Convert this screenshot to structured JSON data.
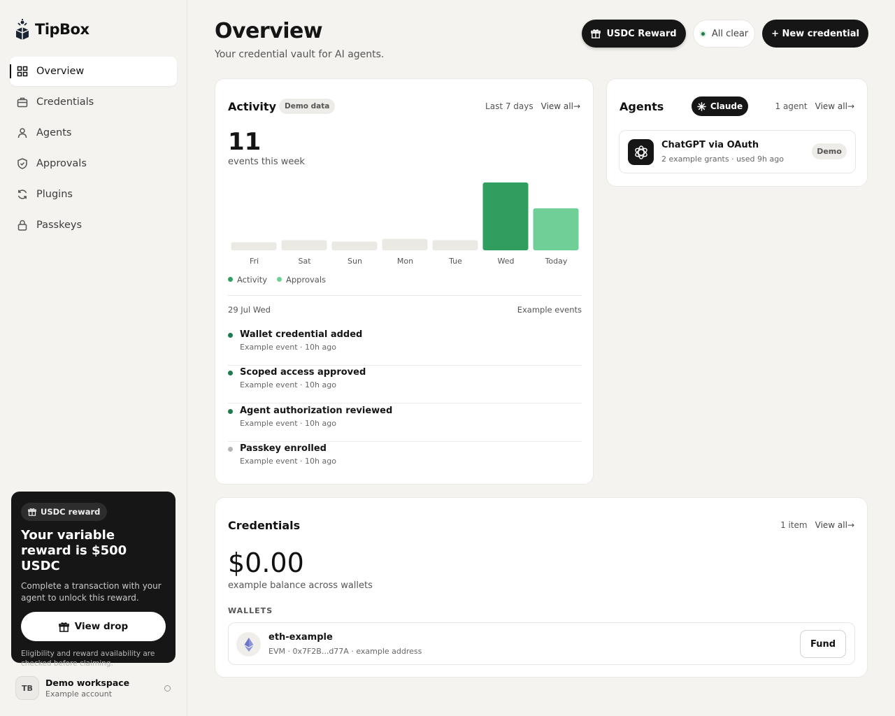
{
  "app": {
    "name": "TipBox"
  },
  "sidebar": {
    "items": [
      {
        "label": "Overview",
        "icon": "grid-icon",
        "active": true
      },
      {
        "label": "Credentials",
        "icon": "briefcase-icon"
      },
      {
        "label": "Agents",
        "icon": "user-icon"
      },
      {
        "label": "Approvals",
        "icon": "shield-check-icon"
      },
      {
        "label": "Plugins",
        "icon": "refresh-icon"
      },
      {
        "label": "Passkeys",
        "icon": "lock-icon"
      }
    ],
    "reward": {
      "pill": "USDC reward",
      "title": "Your variable reward is $500 USDC",
      "description": "Complete a transaction with your agent to unlock this reward.",
      "button": "View drop",
      "note": "Eligibility and reward availability are checked before claiming."
    },
    "workspace": {
      "initials": "TB",
      "name": "Demo workspace",
      "sub": "Example account"
    }
  },
  "header": {
    "title": "Overview",
    "subtitle": "Your credential vault for AI agents.",
    "usdc_button": "USDC Reward",
    "status": "All clear",
    "new_button": "+ New credential"
  },
  "activity": {
    "title": "Activity",
    "badge": "Demo data",
    "range": "Last 7 days",
    "view_all": "View all→",
    "count": "11",
    "count_label": "events this week",
    "legend": [
      "Activity",
      "Approvals"
    ],
    "date": "29 Jul Wed",
    "events_label": "Example events",
    "events": [
      {
        "title": "Wallet credential added",
        "sub": "Example event · 10h ago",
        "status": "green"
      },
      {
        "title": "Scoped access approved",
        "sub": "Example event · 10h ago",
        "status": "green"
      },
      {
        "title": "Agent authorization reviewed",
        "sub": "Example event · 10h ago",
        "status": "green"
      },
      {
        "title": "Passkey enrolled",
        "sub": "Example event · 10h ago",
        "status": "grey"
      }
    ]
  },
  "chart_data": {
    "type": "bar",
    "categories": [
      "Fri",
      "Sat",
      "Sun",
      "Mon",
      "Tue",
      "Wed",
      "Today"
    ],
    "values": [
      0.12,
      0.15,
      0.13,
      0.17,
      0.15,
      1.0,
      0.62
    ],
    "highlight": {
      "Wed": "#2f9e5f",
      "Today": "#6fcf97"
    },
    "base_color": "#ebe9e4"
  },
  "agents": {
    "title": "Agents",
    "filter": "Claude",
    "count": "1 agent",
    "view_all": "View all→",
    "items": [
      {
        "name": "ChatGPT via OAuth",
        "sub": "2 example grants · used 9h ago",
        "badge": "Demo"
      }
    ]
  },
  "credentials": {
    "title": "Credentials",
    "count": "1 item",
    "view_all": "View all→",
    "balance": "$0.00",
    "balance_label": "example balance across wallets",
    "wallets_label": "WALLETS",
    "wallets": [
      {
        "name": "eth-example",
        "sub": "EVM · 0x7F2B...d77A · example address",
        "action": "Fund"
      }
    ]
  },
  "colors": {
    "accent_green": "#2f9e5f",
    "light_green": "#6fcf97",
    "dark": "#161616"
  }
}
